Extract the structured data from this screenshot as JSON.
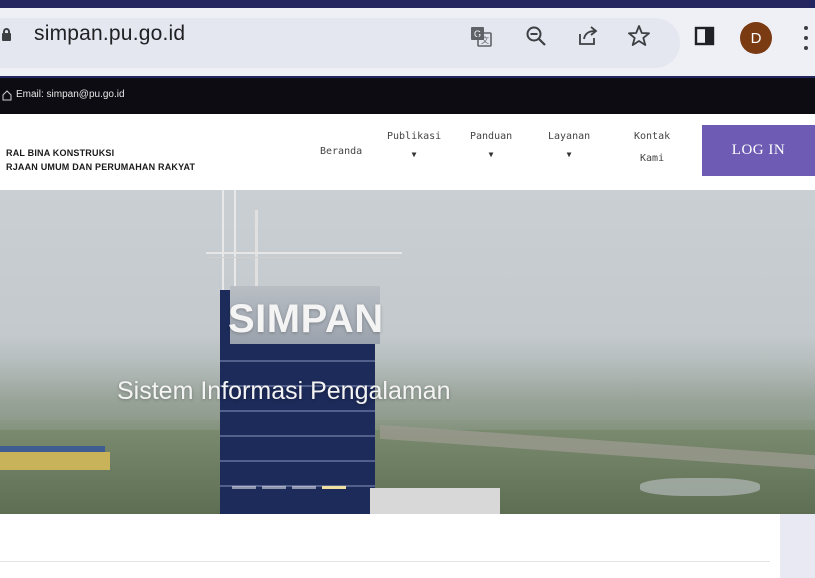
{
  "browser": {
    "url": "simpan.pu.go.id",
    "profile_initial": "D",
    "icons": [
      "translate-icon",
      "zoom-out-icon",
      "share-icon",
      "bookmark-star-icon",
      "side-panel-icon",
      "more-menu-icon"
    ]
  },
  "infobar": {
    "email_text": "Email: simpan@pu.go.id"
  },
  "header": {
    "org_line1": "RAL BINA KONSTRUKSI",
    "org_line2": "RJAAN UMUM DAN PERUMAHAN RAKYAT",
    "nav": [
      {
        "label": "Beranda",
        "dropdown": false
      },
      {
        "label": "Publikasi",
        "dropdown": true
      },
      {
        "label": "Panduan",
        "dropdown": true
      },
      {
        "label": "Layanan",
        "dropdown": true
      },
      {
        "label": "Kontak",
        "label2": "Kami",
        "dropdown": false
      }
    ],
    "login_label": "LOG IN",
    "login_color": "#6e5cb4"
  },
  "hero": {
    "title": "SIMPAN",
    "subtitle": "Sistem Informasi Pengalaman",
    "slides": 4,
    "active_slide": 4
  }
}
